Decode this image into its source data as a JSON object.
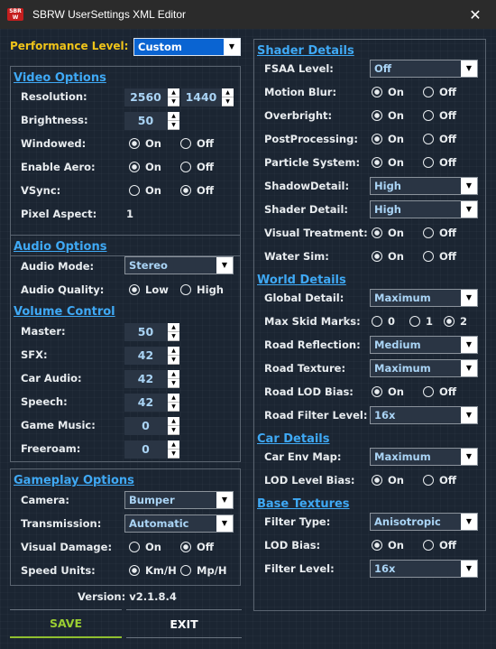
{
  "window": {
    "title": "SBRW UserSettings XML Editor",
    "icon_text_top": "SBR",
    "icon_text_bottom": "W",
    "close": "✕"
  },
  "performance": {
    "label": "Performance Level:",
    "value": "Custom"
  },
  "video": {
    "title": "Video Options",
    "resolution_label": "Resolution:",
    "res_width": "2560",
    "res_height": "1440",
    "brightness_label": "Brightness:",
    "brightness": "50",
    "windowed_label": "Windowed:",
    "windowed": "on",
    "aero_label": "Enable Aero:",
    "aero": "on",
    "vsync_label": "VSync:",
    "vsync": "off",
    "pixel_aspect_label": "Pixel Aspect:",
    "pixel_aspect": "1"
  },
  "audio": {
    "title": "Audio Options",
    "mode_label": "Audio Mode:",
    "mode": "Stereo",
    "quality_label": "Audio Quality:",
    "quality": "Low",
    "low": "Low",
    "high": "High"
  },
  "volume": {
    "title": "Volume Control",
    "master_label": "Master:",
    "master": "50",
    "sfx_label": "SFX:",
    "sfx": "42",
    "car_label": "Car Audio:",
    "car": "42",
    "speech_label": "Speech:",
    "speech": "42",
    "music_label": "Game Music:",
    "music": "0",
    "freeroam_label": "Freeroam:",
    "freeroam": "0"
  },
  "gameplay": {
    "title": "Gameplay Options",
    "camera_label": "Camera:",
    "camera": "Bumper",
    "transmission_label": "Transmission:",
    "transmission": "Automatic",
    "damage_label": "Visual Damage:",
    "damage": "off",
    "units_label": "Speed Units:",
    "units": "Km/H",
    "kmh": "Km/H",
    "mph": "Mp/H"
  },
  "labels": {
    "on": "On",
    "off": "Off"
  },
  "shader": {
    "title": "Shader Details",
    "fsaa_label": "FSAA Level:",
    "fsaa": "Off",
    "motion_label": "Motion Blur:",
    "motion": "on",
    "overbright_label": "Overbright:",
    "overbright": "on",
    "post_label": "PostProcessing:",
    "post": "on",
    "particle_label": "Particle System:",
    "particle": "on",
    "shadow_label": "ShadowDetail:",
    "shadow": "High",
    "shaderdetail_label": "Shader Detail:",
    "shaderdetail": "High",
    "visual_label": "Visual Treatment:",
    "visual": "on",
    "water_label": "Water Sim:",
    "water": "on"
  },
  "world": {
    "title": "World Details",
    "global_label": "Global Detail:",
    "global": "Maximum",
    "skid_label": "Max Skid Marks:",
    "skid": "2",
    "skid_0": "0",
    "skid_1": "1",
    "skid_2": "2",
    "reflection_label": "Road Reflection:",
    "reflection": "Medium",
    "texture_label": "Road Texture:",
    "texture": "Maximum",
    "lod_label": "Road LOD Bias:",
    "lod": "on",
    "filter_label": "Road Filter Level:",
    "filter": "16x"
  },
  "car": {
    "title": "Car Details",
    "env_label": "Car Env Map:",
    "env": "Maximum",
    "lod_label": "LOD Level Bias:",
    "lod": "on"
  },
  "base": {
    "title": "Base Textures",
    "filter_type_label": "Filter Type:",
    "filter_type": "Anisotropic",
    "lod_label": "LOD Bias:",
    "lod": "on",
    "filter_level_label": "Filter Level:",
    "filter_level": "16x"
  },
  "footer": {
    "version": "Version: v2.1.8.4",
    "save": "SAVE",
    "exit": "EXIT"
  },
  "colors": {
    "accent": "#3fa9f5",
    "perf_label": "#f0c419",
    "save": "#9acd32",
    "selected": "#0a64d2"
  }
}
